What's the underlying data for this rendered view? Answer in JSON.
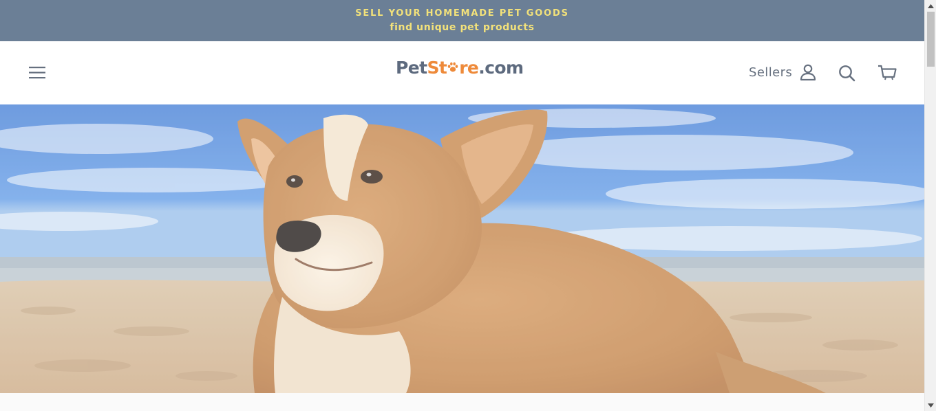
{
  "announcement": {
    "line1": "SELL YOUR HOMEMADE PET GOODS",
    "line2": "find unique pet products"
  },
  "header": {
    "logo": {
      "part1": "Pet",
      "part2a": "St",
      "part2b": "re",
      "part3": ".com"
    },
    "sellers_label": "Sellers",
    "icons": [
      "menu-icon",
      "user-icon",
      "search-icon",
      "cart-icon"
    ]
  },
  "hero": {
    "subject": "corgi dog lying on a sandy beach under a blue sky"
  },
  "colors": {
    "announcement_bg": "#6b7f96",
    "announcement_text": "#f3e27a",
    "logo_gray": "#5d6a7e",
    "logo_orange": "#ee8a3a",
    "icon_gray": "#66707f"
  }
}
